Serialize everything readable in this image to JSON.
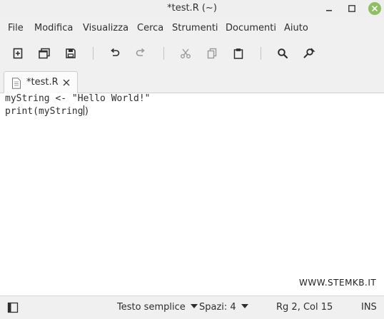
{
  "window": {
    "title": "*test.R (~)"
  },
  "menu": [
    "File",
    "Modifica",
    "Visualizza",
    "Cerca",
    "Strumenti",
    "Documenti",
    "Aiuto"
  ],
  "toolbar": {
    "icons": [
      "new-document-icon",
      "new-window-icon",
      "save-icon",
      "undo-icon",
      "redo-icon",
      "cut-icon",
      "copy-icon",
      "paste-icon",
      "search-icon",
      "replace-icon"
    ]
  },
  "tab": {
    "label": "*test.R"
  },
  "editor": {
    "lines": [
      "myString <- \"Hello World!\"",
      "print(myString",
      ")"
    ],
    "cursor": "Rg 2, Col 15"
  },
  "watermark": "WWW.STEMKB.IT",
  "status": {
    "language": "Testo semplice",
    "indent": "Spazi: 4",
    "position": "Rg 2, Col 15",
    "mode": "INS"
  },
  "colors": {
    "close_button": "#8fbf63",
    "editor_bg": "#ffffff",
    "chrome_bg": "#f0f0f0"
  }
}
